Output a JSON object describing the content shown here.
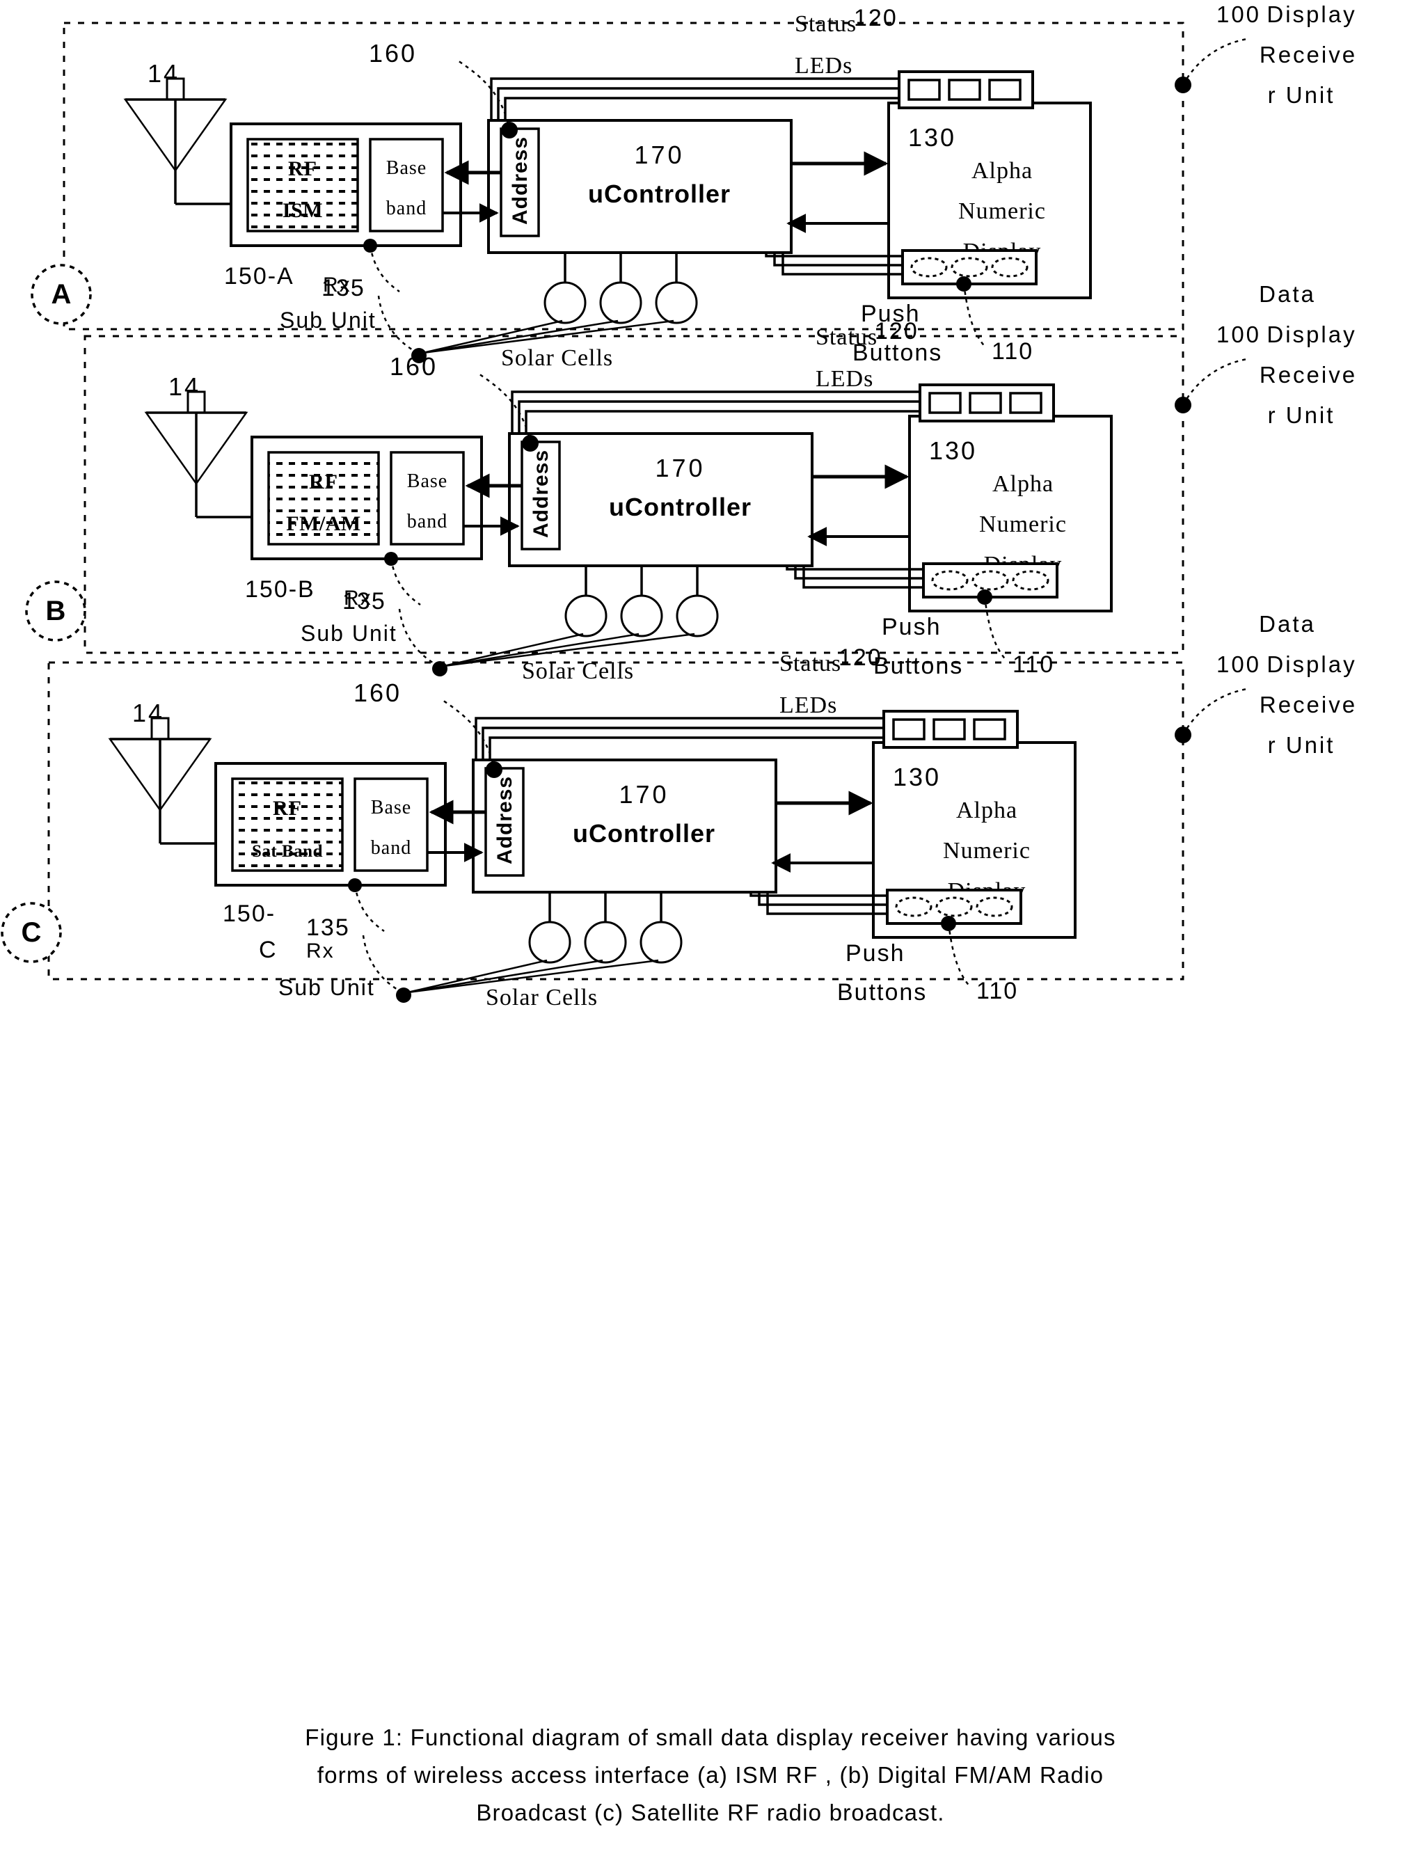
{
  "figure": {
    "caption_lines": [
      "Figure 1: Functional diagram of small data display receiver having various",
      "forms of wireless access interface (a) ISM RF , (b) Digital FM/AM Radio",
      "Broadcast (c) Satellite RF radio broadcast."
    ],
    "title_number": "Figure 1"
  },
  "common": {
    "antenna_ref": "14",
    "address_ref": "160",
    "address_label": "Address",
    "controller_ref": "170",
    "controller_label": "uController",
    "baseband_label_line1": "Base",
    "baseband_label_line2": "band",
    "rf_label_line1": "RF",
    "display_ref": "130",
    "display_line1": "Alpha",
    "display_line2": "Numeric",
    "display_line3": "Display",
    "status_led_ref": "120",
    "status_led_line1": "Status",
    "status_led_line2": "LEDs",
    "push_buttons_ref": "110",
    "push_buttons_line1": "Push",
    "push_buttons_line2": "Buttons",
    "solar_cells_ref": "135",
    "solar_cells_label": "Solar Cells",
    "unit_ref": "100",
    "unit_line1": "Data",
    "unit_line2": "Display",
    "unit_line3": "Receive",
    "unit_line4": "r Unit",
    "rx_sub_unit_line1": "Rx",
    "rx_sub_unit_line2": "Sub Unit"
  },
  "panels": [
    {
      "key": "A",
      "badge": "A",
      "rf_variant": "ISM",
      "rf_label_line2": "ISM",
      "subunit_ref": "150-A",
      "subunit_ref_line2": ""
    },
    {
      "key": "B",
      "badge": "B",
      "rf_variant": "FM/AM",
      "rf_label_line2": "FM/AM",
      "subunit_ref": "150-B",
      "subunit_ref_line2": ""
    },
    {
      "key": "C",
      "badge": "C",
      "rf_variant": "Sat Band",
      "rf_label_line2": "Sat Band",
      "subunit_ref": "150-",
      "subunit_ref_line2": "C"
    }
  ],
  "colors": {
    "stroke": "#000000",
    "background": "#ffffff"
  }
}
